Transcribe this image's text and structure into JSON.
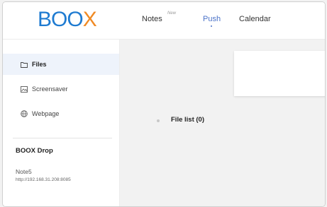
{
  "header": {
    "logo": {
      "part1": "BOO",
      "part2": "X"
    },
    "nav": {
      "notes": "Notes",
      "notes_badge": "New",
      "push": "Push",
      "calendar": "Calendar"
    }
  },
  "sidebar": {
    "items": [
      {
        "label": "Files",
        "icon": "folder-icon",
        "active": true
      },
      {
        "label": "Screensaver",
        "icon": "image-icon",
        "active": false
      },
      {
        "label": "Webpage",
        "icon": "globe-icon",
        "active": false
      }
    ],
    "drop": {
      "title": "BOOX Drop",
      "device": "Note5",
      "url": "http://192.168.31.208:8085"
    }
  },
  "main": {
    "file_list": "File list (0)"
  },
  "colors": {
    "logo_blue": "#1f7bd1",
    "logo_orange": "#f08a24",
    "accent": "#4a72c8",
    "active_bg": "#eef3fb"
  }
}
